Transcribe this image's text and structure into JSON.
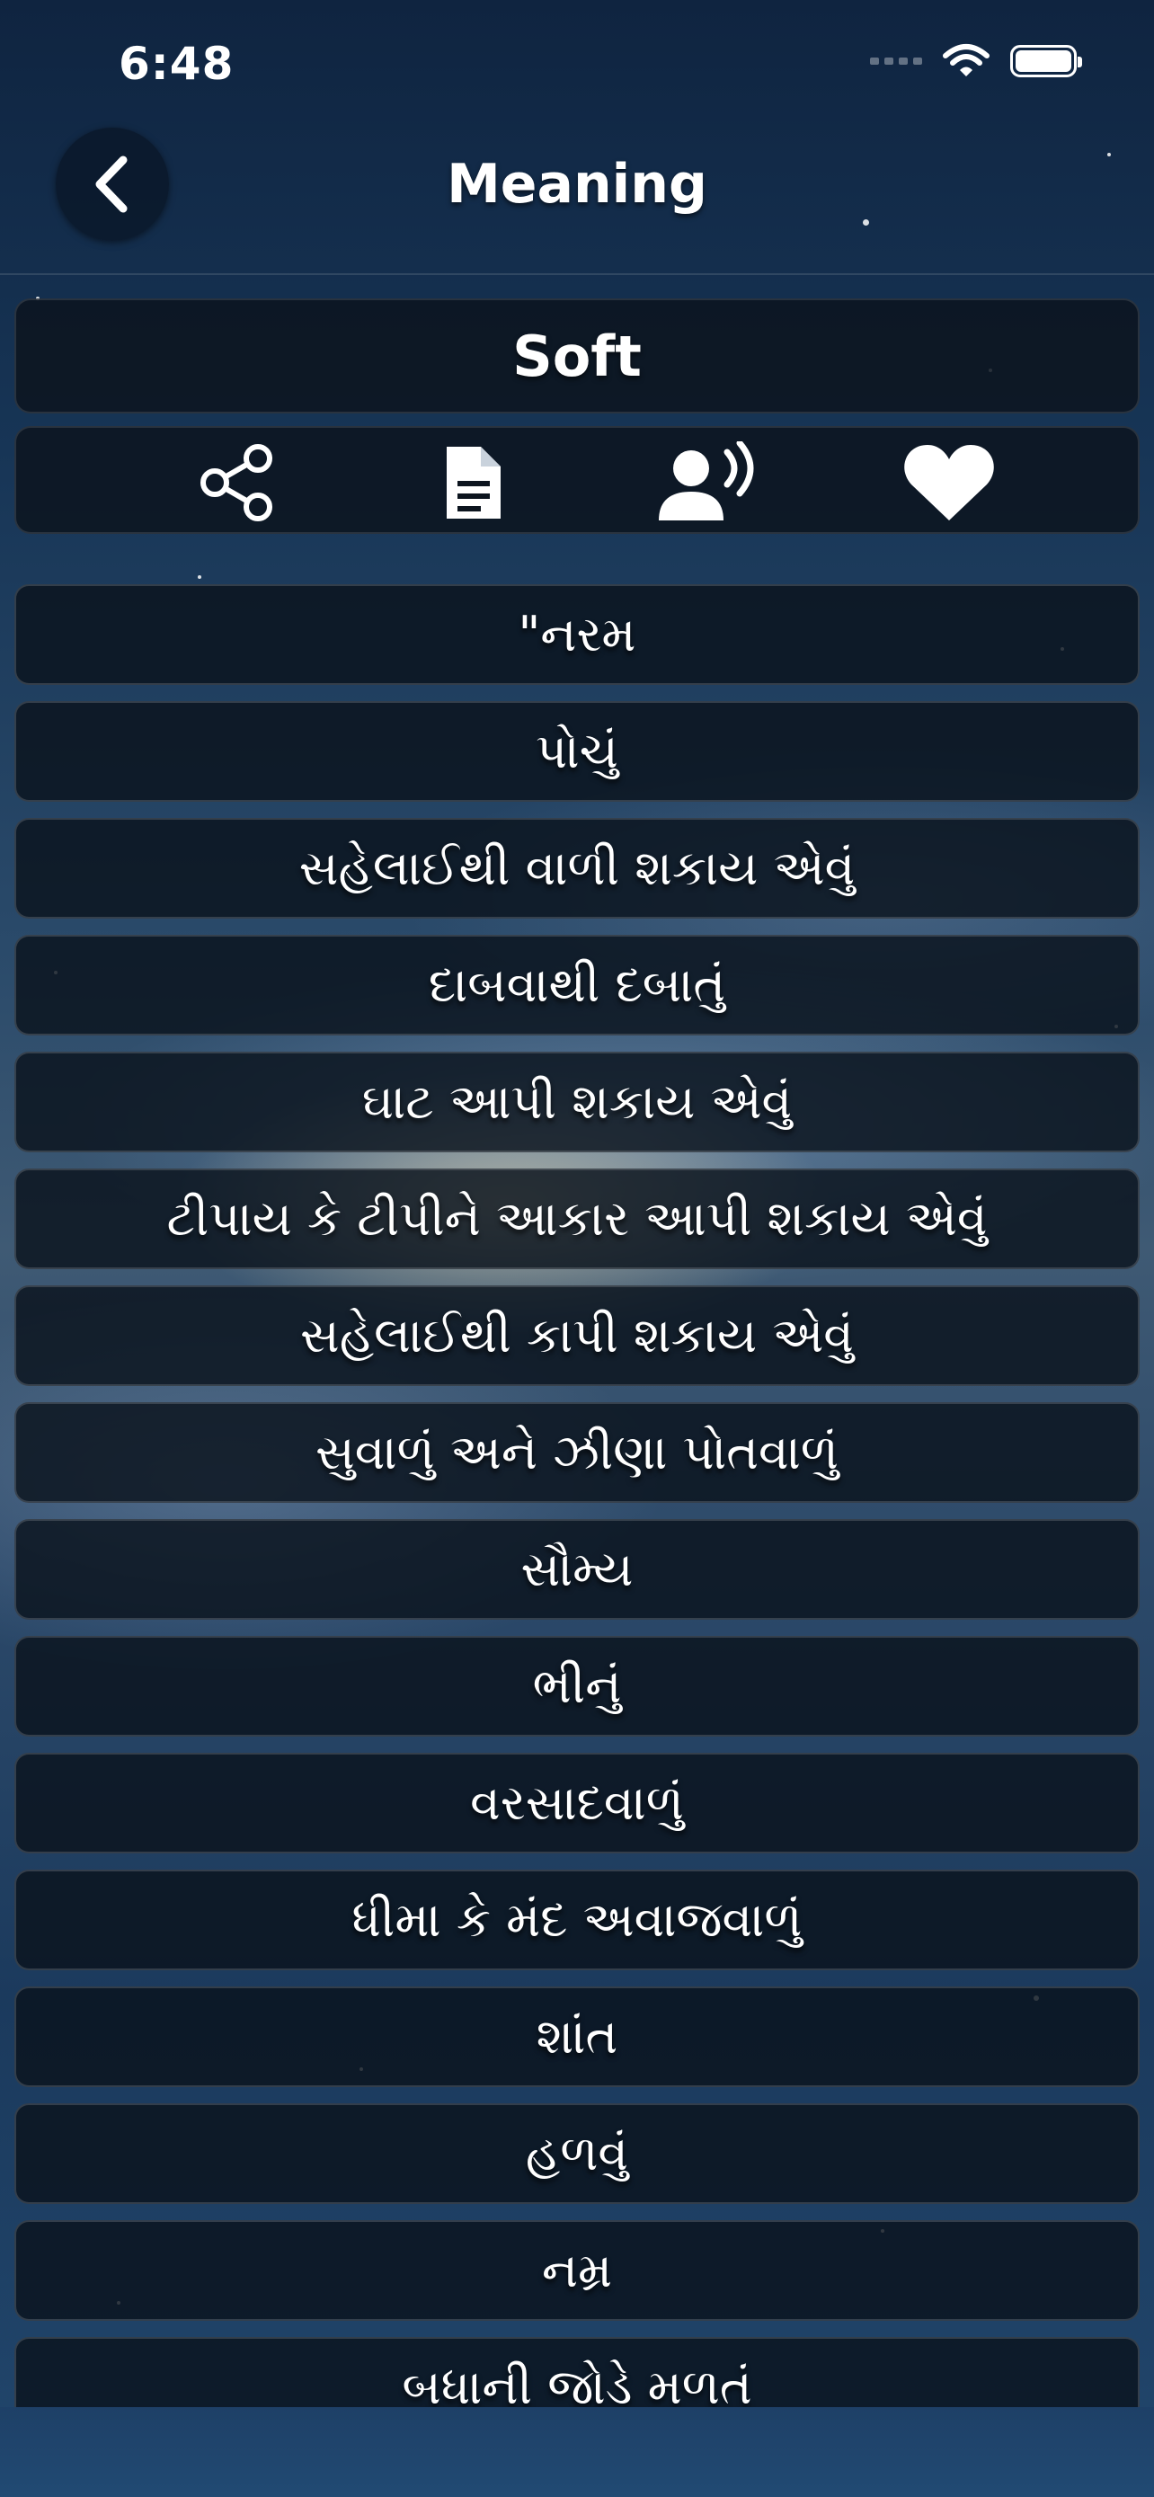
{
  "status_bar": {
    "time": "6:48"
  },
  "header": {
    "title": "Meaning",
    "back_icon": "chevron-left-icon"
  },
  "word": "Soft",
  "actions": [
    {
      "name": "share-button",
      "icon": "share-icon"
    },
    {
      "name": "document-button",
      "icon": "document-icon"
    },
    {
      "name": "speak-button",
      "icon": "speaker-voice-icon"
    },
    {
      "name": "favorite-button",
      "icon": "heart-icon"
    }
  ],
  "meanings": [
    "\"નરમ",
    "પોચું",
    "સહેલાઈથી વાળી શકાય એવું",
    "દાબવાથી દબાતું",
    "ઘાટ આપી શકાય એવું",
    "ટીપાય કે ટીપીને આકાર આપી શકાય એવું",
    "સહેલાઈથી કાપી શકાય એવું",
    "સુવાળું અને ઝીણા પોતવાળું",
    "સૌમ્ય",
    "ભીનું",
    "વરસાદવાળું",
    "ધીમા કે મંદ અવાજવાળું",
    "શાંત",
    "હળવું",
    "નમ્ર",
    "બધાની જોડે મળતં"
  ]
}
